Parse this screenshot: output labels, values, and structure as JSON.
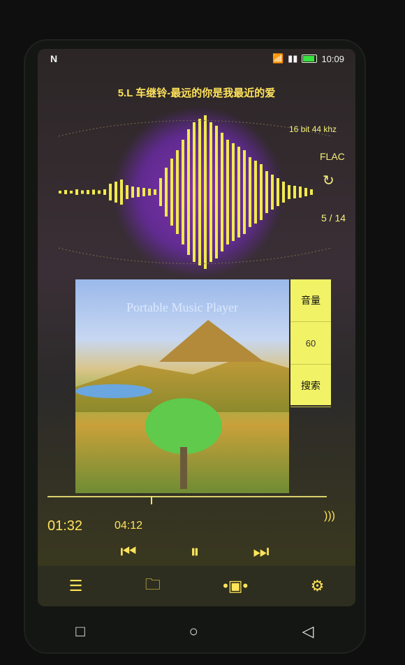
{
  "status": {
    "logo": "N",
    "time": "10:09"
  },
  "track": {
    "title": "5.L 车继铃-最远的你是我最近的爱",
    "bit_rate": "16 bit 44 khz",
    "format": "FLAC",
    "position": "5 / 14"
  },
  "album": {
    "title": "Portable Music Player"
  },
  "side": {
    "volume_label": "音量",
    "volume_value": "60",
    "search_label": "搜索"
  },
  "playback": {
    "current": "01:32",
    "total": "04:12",
    "progress": 0.37
  },
  "icons": {
    "repeat": "repeat-icon",
    "sound": "sound-icon",
    "prev": "prev-icon",
    "pause": "pause-icon",
    "next": "next-icon",
    "menu": "menu-icon",
    "folder": "folder-icon",
    "video": "video-icon",
    "settings": "settings-icon",
    "square": "recent-apps-icon",
    "circle": "home-icon",
    "triangle": "back-icon"
  }
}
